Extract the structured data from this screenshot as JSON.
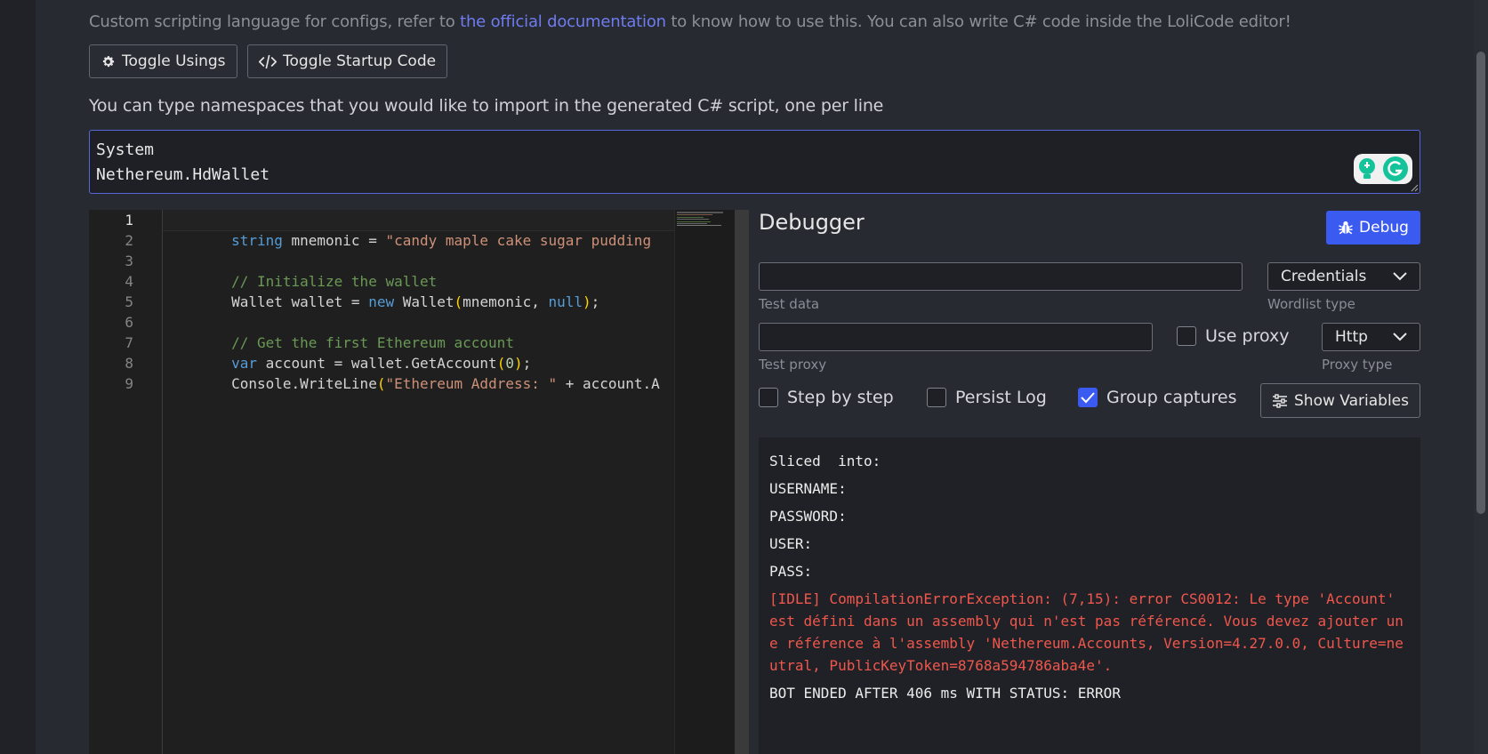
{
  "description": {
    "before": "Custom scripting language for configs, refer to ",
    "link": "the official documentation",
    "after": " to know how to use this. You can also write C# code inside the LoliCode editor!"
  },
  "toolbar": {
    "toggle_usings": "Toggle Usings",
    "toggle_startup": "Toggle Startup Code"
  },
  "usings": {
    "hint": "You can type namespaces that you would like to import in the generated C# script, one per line",
    "lines": [
      "System",
      "Nethereum.HdWallet"
    ]
  },
  "editor": {
    "line_numbers": [
      "1",
      "2",
      "3",
      "4",
      "5",
      "6",
      "7",
      "8",
      "9"
    ],
    "code": {
      "l2_kw": "string",
      "l2_rest": " mnemonic = ",
      "l2_str": "\"candy maple cake sugar pudding",
      "l4_cm": "// Initialize the wallet",
      "l5_a": "Wallet wallet = ",
      "l5_kw": "new",
      "l5_b": " Wallet",
      "l5_p1": "(",
      "l5_c": "mnemonic, ",
      "l5_null": "null",
      "l5_p2": ")",
      "l5_d": ";",
      "l7_cm": "// Get the first Ethereum account",
      "l8_kw": "var",
      "l8_a": " account = wallet.GetAccount",
      "l8_p1": "(",
      "l8_num": "0",
      "l8_p2": ")",
      "l8_b": ";",
      "l9_a": "Console.WriteLine",
      "l9_p1": "(",
      "l9_str": "\"Ethereum Address: \"",
      "l9_b": " + account.A"
    }
  },
  "debugger": {
    "title": "Debugger",
    "debug_button": "Debug",
    "test_data_label": "Test data",
    "test_data_value": "",
    "wordlist_type_value": "Credentials",
    "wordlist_type_label": "Wordlist type",
    "test_proxy_label": "Test proxy",
    "test_proxy_value": "",
    "use_proxy_label": "Use proxy",
    "proxy_type_value": "Http",
    "proxy_type_label": "Proxy type",
    "step_by_step": "Step by step",
    "persist_log": "Persist Log",
    "group_captures": "Group captures",
    "show_variables": "Show Variables",
    "checkboxes": {
      "use_proxy": false,
      "step_by_step": false,
      "persist_log": false,
      "group_captures": true
    }
  },
  "log": {
    "lines": [
      "Sliced  into:",
      "USERNAME:",
      "PASSWORD:",
      "USER:",
      "PASS:"
    ],
    "error": "[IDLE] CompilationErrorException: (7,15): error CS0012: Le type 'Account' est défini dans un assembly qui n'est pas référencé. Vous devez ajouter une référence à l'assembly 'Nethereum.Accounts, Version=4.27.0.0, Culture=neutral, PublicKeyToken=8768a594786aba4e'.",
    "status": "BOT ENDED AFTER 406 ms WITH STATUS: ERROR"
  },
  "colors": {
    "accent": "#3b5bf0",
    "link": "#6e7cf0",
    "error": "#f0574c"
  }
}
